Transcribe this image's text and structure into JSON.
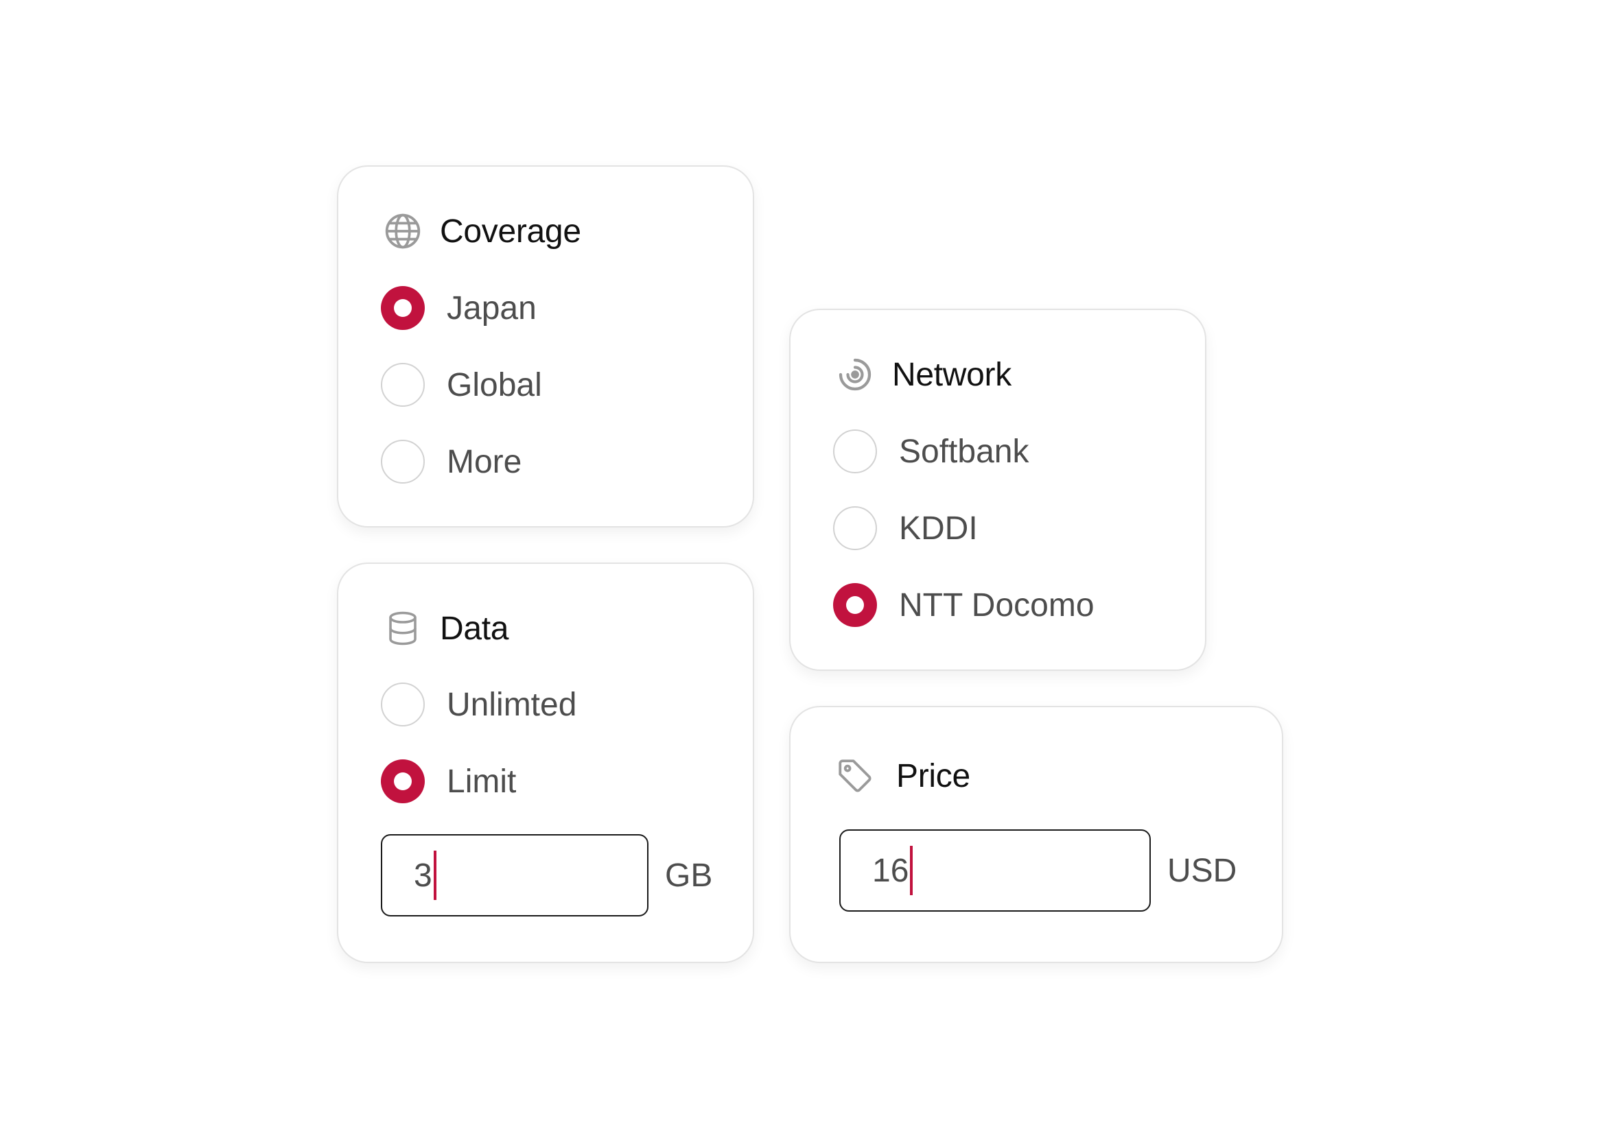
{
  "accent_color": "#c1123e",
  "coverage": {
    "title": "Coverage",
    "icon": "globe-icon",
    "options": [
      {
        "label": "Japan",
        "selected": true
      },
      {
        "label": "Global",
        "selected": false
      },
      {
        "label": "More",
        "selected": false
      }
    ]
  },
  "data": {
    "title": "Data",
    "icon": "database-icon",
    "options": [
      {
        "label": "Unlimted",
        "selected": false
      },
      {
        "label": "Limit",
        "selected": true
      }
    ],
    "limit_value": "3",
    "limit_unit": "GB"
  },
  "network": {
    "title": "Network",
    "icon": "signal-icon",
    "options": [
      {
        "label": "Softbank",
        "selected": false
      },
      {
        "label": "KDDI",
        "selected": false
      },
      {
        "label": "NTT Docomo",
        "selected": true
      }
    ]
  },
  "price": {
    "title": "Price",
    "icon": "tag-icon",
    "value": "16",
    "unit": "USD"
  }
}
